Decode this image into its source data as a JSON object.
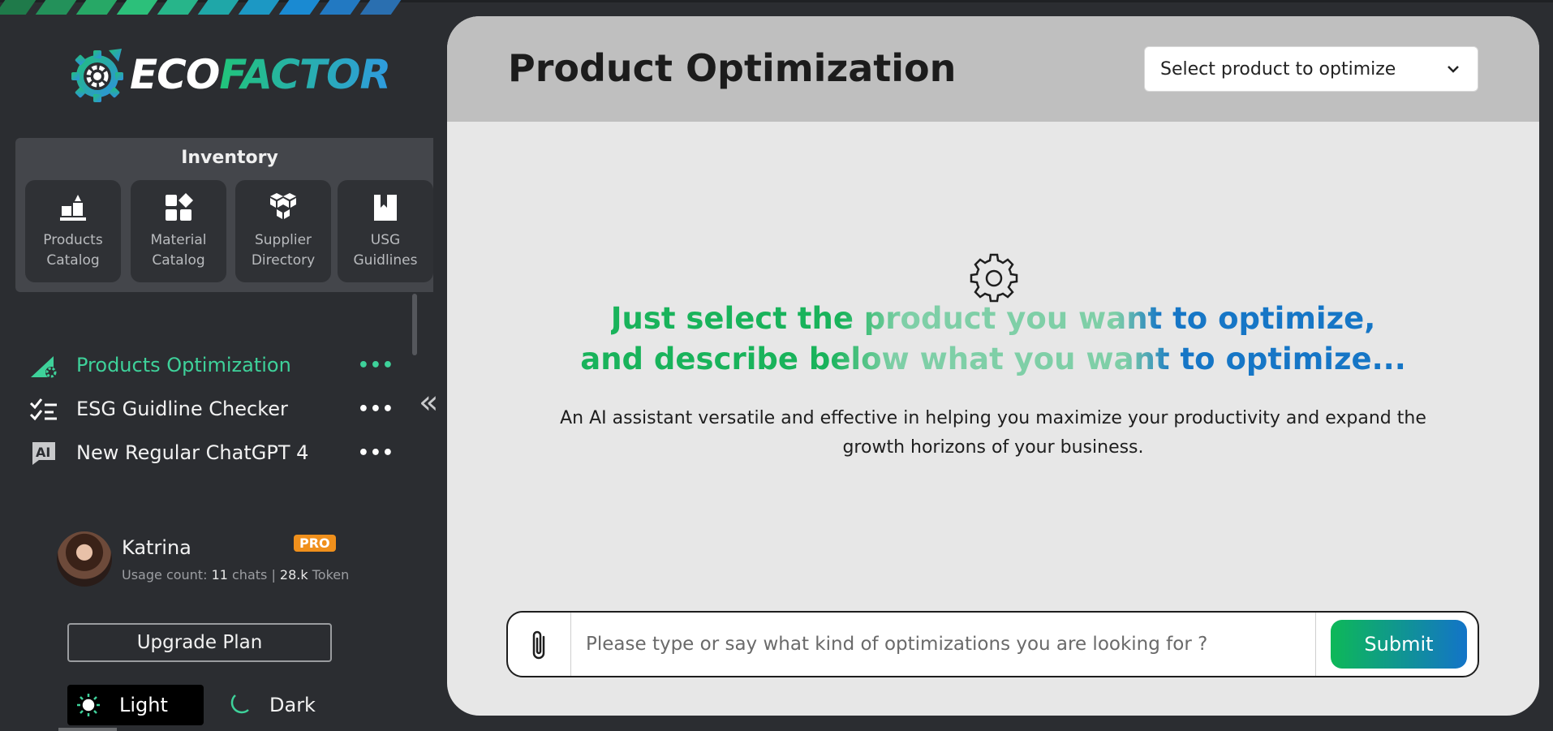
{
  "brand": {
    "name_part1": "ECO",
    "name_part2": "FACTOR",
    "stripe_colors": [
      "#1f7a4a",
      "#23915a",
      "#27a866",
      "#2cc07a",
      "#27b58a",
      "#1fa7a8",
      "#1c98c4",
      "#1a8ad2",
      "#2279c2",
      "#2a6fb0"
    ]
  },
  "sidebar": {
    "inventory": {
      "title": "Inventory",
      "items": [
        {
          "label_line1": "Products",
          "label_line2": "Catalog",
          "icon": "products-catalog-icon"
        },
        {
          "label_line1": "Material",
          "label_line2": "Catalog",
          "icon": "material-catalog-icon"
        },
        {
          "label_line1": "Supplier",
          "label_line2": "Directory",
          "icon": "supplier-directory-icon"
        },
        {
          "label_line1": "USG",
          "label_line2": "Guidlines",
          "icon": "bookmark-book-icon"
        }
      ]
    },
    "nav": [
      {
        "label": "Products Optimization",
        "more": "•••",
        "active": true,
        "icon": "optimization-icon"
      },
      {
        "label": "ESG Guidline Checker",
        "more": "•••",
        "active": false,
        "icon": "checklist-icon"
      },
      {
        "label": "New Regular ChatGPT 4",
        "more": "•••",
        "active": false,
        "icon": "ai-chat-icon"
      }
    ],
    "collapse_glyph": "«",
    "user": {
      "name": "Katrina",
      "badge": "PRO",
      "usage_prefix": "Usage count: ",
      "chats_count": "11",
      "chats_label": " chats | ",
      "tokens_count": "28.k",
      "tokens_label": " Token"
    },
    "upgrade_label": "Upgrade Plan",
    "theme": {
      "light_label": "Light",
      "dark_label": "Dark",
      "selected": "Light"
    }
  },
  "main": {
    "title": "Product Optimization",
    "product_select": {
      "value": "Select product to optimize"
    },
    "headline_line1": "Just select the product you want to optimize,",
    "headline_line2": "and describe below what you want to optimize...",
    "subtext": "An AI assistant versatile and effective in helping you maximize your productivity and expand the growth horizons of your business.",
    "composer": {
      "placeholder": "Please type or say what kind of optimizations you are looking for ?",
      "submit_label": "Submit"
    }
  },
  "colors": {
    "accent_green": "#3ed19a",
    "brand_green": "#19b35b",
    "brand_blue": "#1676c6",
    "pro_badge": "#f0901c",
    "sidebar_bg": "#2b2d31",
    "main_bg": "#e7e7e7"
  }
}
